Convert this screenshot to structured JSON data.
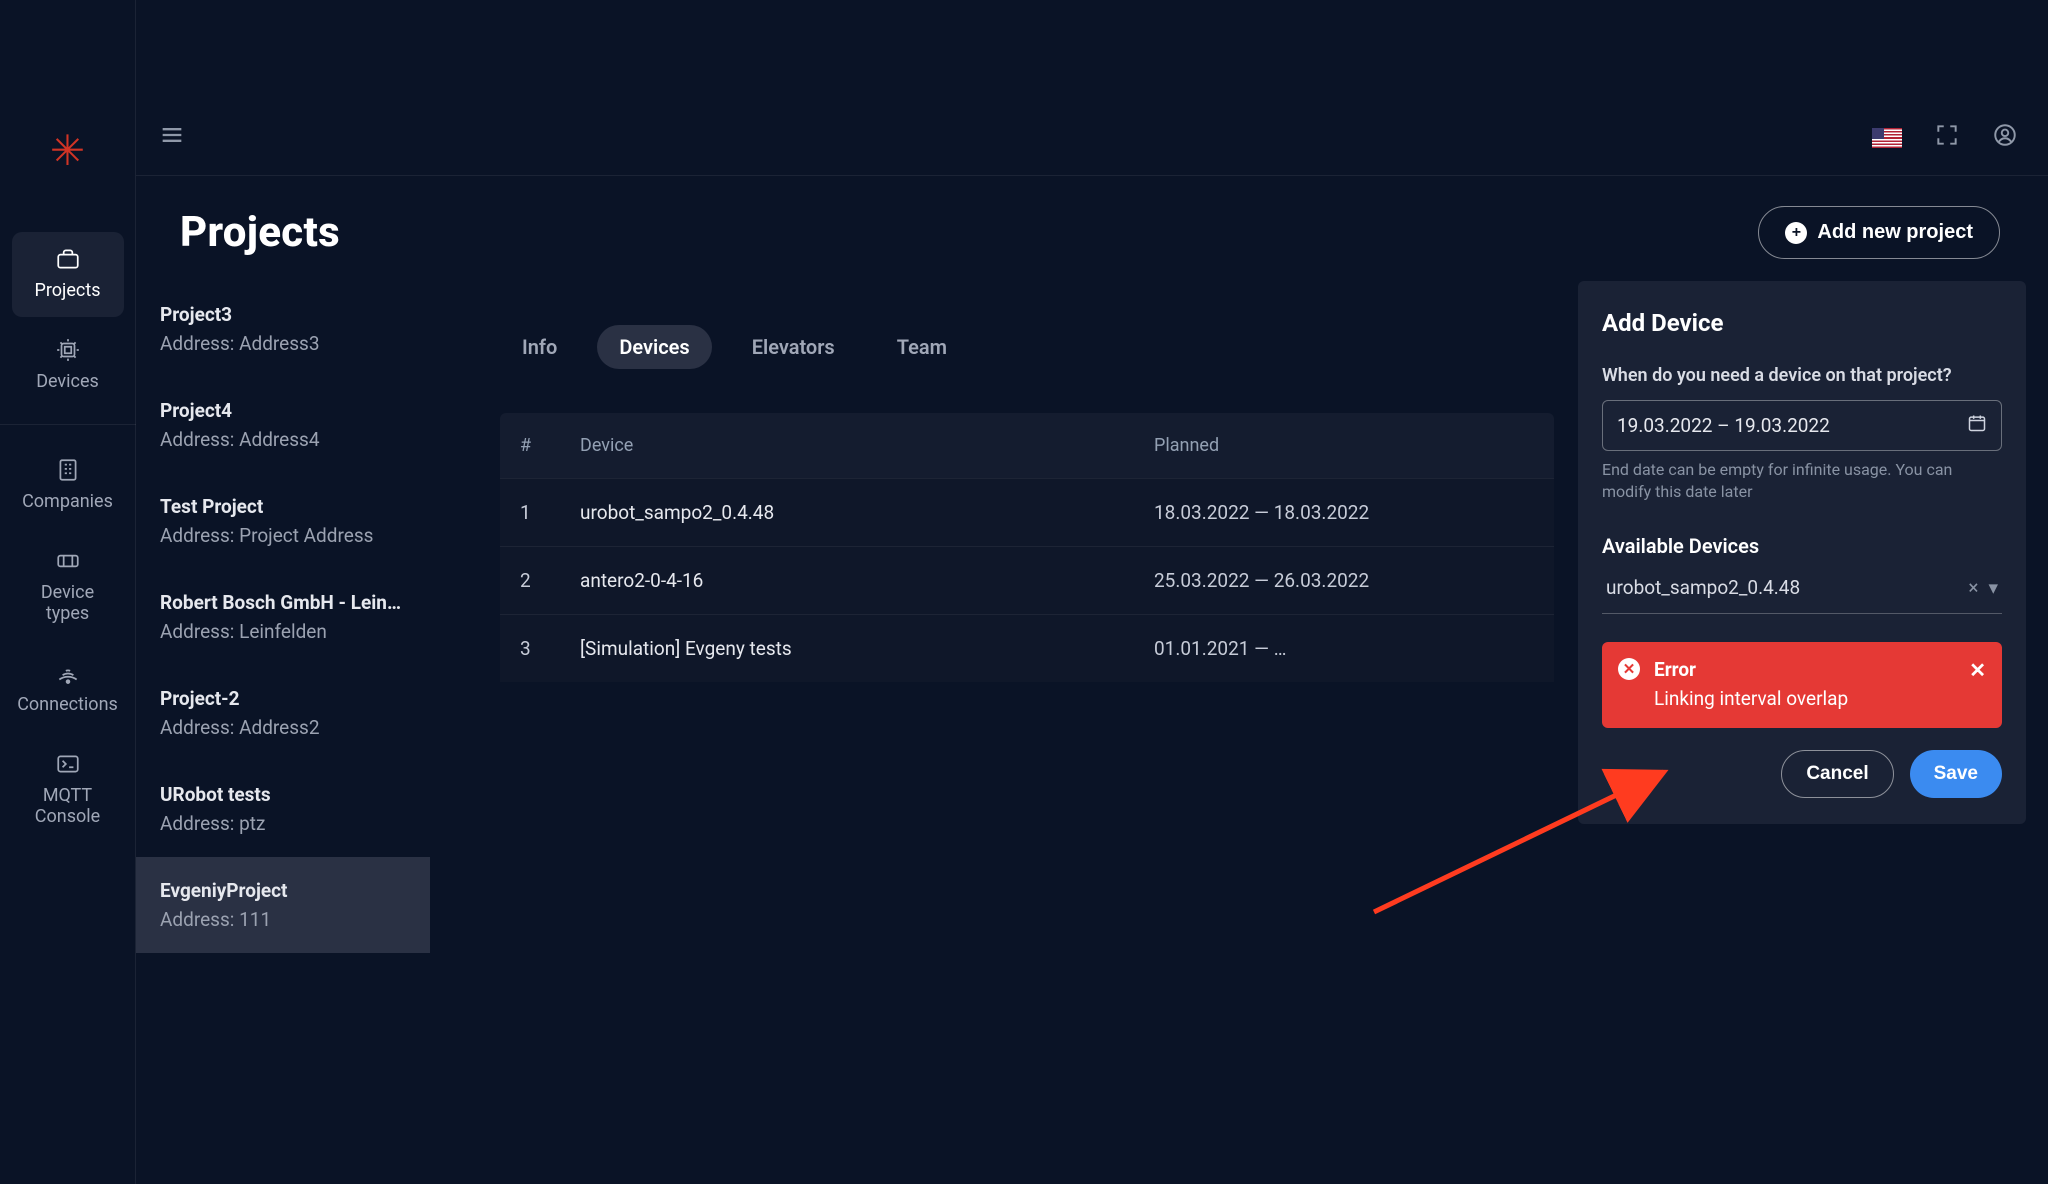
{
  "sidebar": {
    "items": [
      {
        "label": "Projects",
        "icon": "briefcase"
      },
      {
        "label": "Devices",
        "icon": "chip"
      },
      {
        "label": "Companies",
        "icon": "office"
      },
      {
        "label": "Device types",
        "icon": "ticket"
      },
      {
        "label": "Connections",
        "icon": "signal"
      },
      {
        "label": "MQTT Console",
        "icon": "terminal"
      }
    ]
  },
  "header": {
    "page_title": "Projects",
    "add_button": "Add new project"
  },
  "projects": [
    {
      "name": "Project3",
      "address_label": "Address: Address3"
    },
    {
      "name": "Project4",
      "address_label": "Address: Address4"
    },
    {
      "name": "Test Project",
      "address_label": "Address: Project Address"
    },
    {
      "name": "Robert Bosch GmbH - Lein…",
      "address_label": "Address: Leinfelden"
    },
    {
      "name": "Project-2",
      "address_label": "Address: Address2"
    },
    {
      "name": "URobot tests",
      "address_label": "Address: ptz"
    },
    {
      "name": "EvgeniyProject",
      "address_label": "Address: 111"
    }
  ],
  "tabs": {
    "items": [
      "Info",
      "Devices",
      "Elevators",
      "Team"
    ],
    "active_index": 1
  },
  "table": {
    "columns": {
      "num": "#",
      "device": "Device",
      "planned": "Planned"
    },
    "rows": [
      {
        "num": "1",
        "device": "urobot_sampo2_0.4.48",
        "planned": "18.03.2022 — 18.03.2022"
      },
      {
        "num": "2",
        "device": "antero2-0-4-16",
        "planned": "25.03.2022 — 26.03.2022"
      },
      {
        "num": "3",
        "device": "[Simulation] Evgeny tests",
        "planned": "01.01.2021 — …"
      }
    ]
  },
  "panel": {
    "title": "Add Device",
    "date_question": "When do you need a device on that project?",
    "date_value": "19.03.2022 – 19.03.2022",
    "date_hint": "End date can be empty for infinite usage. You can modify this date later",
    "available_label": "Available Devices",
    "available_selected": "urobot_sampo2_0.4.48",
    "error_title": "Error",
    "error_message": "Linking interval overlap",
    "cancel": "Cancel",
    "save": "Save"
  },
  "colors": {
    "bg": "#0a1326",
    "panel": "#1a2235",
    "accent": "#3b8bf0",
    "error": "#e53935",
    "logo": "#d13425"
  }
}
